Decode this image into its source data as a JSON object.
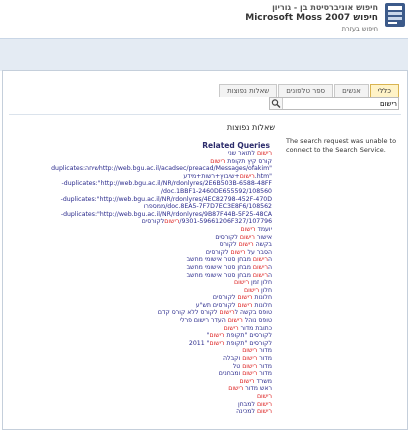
{
  "header": {
    "line1": "חיפוש אוניברסיטת בן - גוריון",
    "line2": "Microsoft Moss 2007 חיפוש",
    "line3": "חיפוש בעזרת"
  },
  "tabs": [
    "כללי",
    "אנשים",
    "ספר טלפונים",
    "שאלות נפוצות"
  ],
  "search": {
    "value": "רישום"
  },
  "error": "The search request was unable to connect to the Search Service.",
  "heading": "שאלות נפוצות",
  "related": {
    "title": "Related Queries",
    "items": [
      {
        "pre": "",
        "hl": "רישום",
        "post": " לתואר שני"
      },
      {
        "pre": "קורס קיץ תקופת ",
        "hl": "רישום",
        "post": ""
      },
      {
        "pre": "\"http://web.bgu.ac.il/acadsec/preacad/Messages/ofakim",
        "hl": "",
        "post": "שיחה:duplicates"
      },
      {
        "pre": "\"htm.",
        "hl": "רישום",
        "post": "+שיבוץ+רשות+מידע"
      },
      {
        "pre": "duplicates:\"http://web.bgu.ac.il/NR/rdonlyres/2E6B503B-6588-48FF-",
        "hl": "",
        "post": ""
      },
      {
        "pre": "doc.1",
        "hl": "",
        "post": "BBF1-2460DE655592/108560/"
      },
      {
        "pre": "duplicates:\"http://web.bgu.ac.il/NR/rdonlyres/4EC82798-452F-470D-",
        "hl": "",
        "post": ""
      },
      {
        "pre": "doc.",
        "hl": "",
        "post": "8EA5-7F7D7EC3E8F6/108562/ממספרו"
      },
      {
        "pre": "duplicates:\"http://web.bgu.ac.il/NR/rdonlyres/9B87F44B-5F25-48CA-",
        "hl": "",
        "post": ""
      },
      {
        "pre": "9301-59661206F327/107796/",
        "hl": "רישום",
        "post": "לקורסים"
      },
      {
        "pre": "יועמד ",
        "hl": "רישום",
        "post": ""
      },
      {
        "pre": "אישור ",
        "hl": "רישום",
        "post": " לקורסים"
      },
      {
        "pre": "בקשה ",
        "hl": "רישום",
        "post": " לקורס"
      },
      {
        "pre": "הסבר על ",
        "hl": "רישום",
        "post": " לקורסים"
      },
      {
        "pre": "ה",
        "hl": "רישום",
        "post": " מבחן סטר אישומי מחשב"
      },
      {
        "pre": "ה",
        "hl": "רישום",
        "post": " מבחן סטר אישומי מחשב"
      },
      {
        "pre": "ה",
        "hl": "רישום",
        "post": " מבחן סטר אישומי מחשב"
      },
      {
        "pre": "חלון זמן ",
        "hl": "רישום",
        "post": ""
      },
      {
        "pre": "חלון ",
        "hl": "רישום",
        "post": ""
      },
      {
        "pre": "חלונות ",
        "hl": "רישום",
        "post": " לקורסים"
      },
      {
        "pre": "חלונות ",
        "hl": "רישום",
        "post": " לקורסים תש\"ע"
      },
      {
        "pre": "טופס בקשה ל",
        "hl": "רישום",
        "post": " לקורס ללא קורס קדם"
      },
      {
        "pre": "טופס נוהל ",
        "hl": "רישום",
        "post": " העדר רישום פרלי"
      },
      {
        "pre": "כתובת מדור ",
        "hl": "רישום",
        "post": ""
      },
      {
        "pre": "לקורסים \"תקופת ",
        "hl": "רישום",
        "post": "\""
      },
      {
        "pre": "לקורסים \"תקופת ",
        "hl": "רישום",
        "post": "\" 2011"
      },
      {
        "pre": "מדור ",
        "hl": "רישום",
        "post": ""
      },
      {
        "pre": "מדור ",
        "hl": "רישום",
        "post": " וקבלה"
      },
      {
        "pre": "מדור ",
        "hl": "רישום",
        "post": " טל"
      },
      {
        "pre": "מדור ",
        "hl": "רישום",
        "post": " ומבחנים"
      },
      {
        "pre": "משרד ",
        "hl": "רישום",
        "post": ""
      },
      {
        "pre": "ראש מדור ",
        "hl": "רישום",
        "post": ""
      },
      {
        "pre": "",
        "hl": "רישום",
        "post": ""
      },
      {
        "pre": "",
        "hl": "רישום",
        "post": " למבחן"
      },
      {
        "pre": "",
        "hl": "רישום",
        "post": " למכינה"
      }
    ]
  }
}
